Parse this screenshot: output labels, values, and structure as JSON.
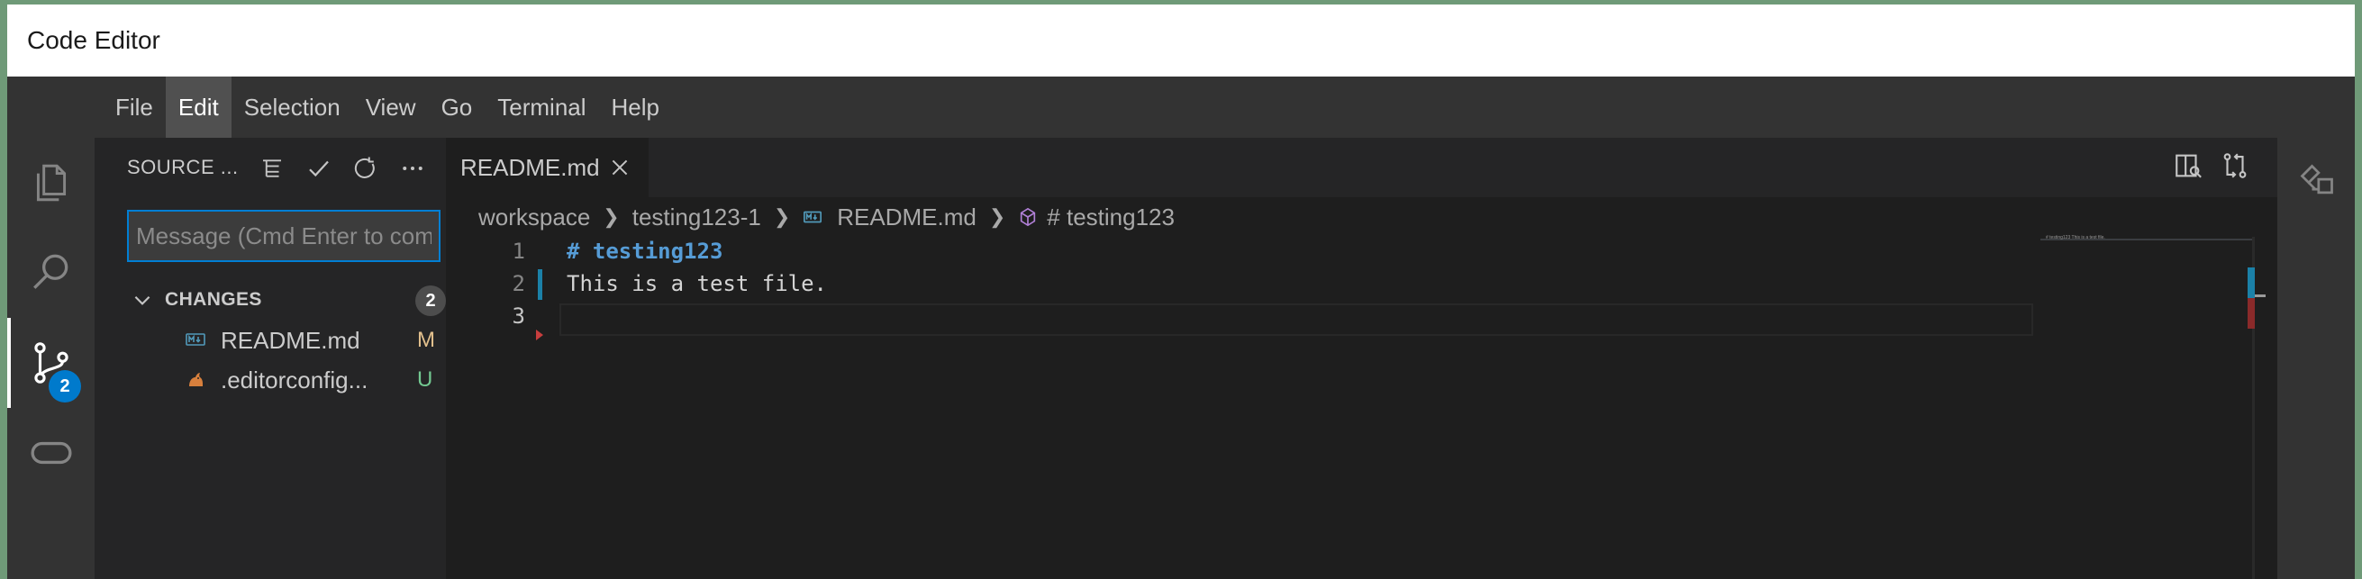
{
  "window": {
    "title": "Code Editor"
  },
  "menu": [
    "File",
    "Edit",
    "Selection",
    "View",
    "Go",
    "Terminal",
    "Help"
  ],
  "activity": {
    "items": [
      {
        "name": "explorer",
        "icon": "files-icon"
      },
      {
        "name": "search",
        "icon": "search-icon"
      },
      {
        "name": "source-control",
        "icon": "source-control-icon",
        "badge": "2"
      },
      {
        "name": "remote",
        "icon": "remote-icon"
      }
    ]
  },
  "sidebar": {
    "title": "SOURCE ...",
    "message_placeholder": "Message (Cmd Enter to commit)",
    "changes_label": "CHANGES",
    "changes_count": "2",
    "files": [
      {
        "name": "README.md",
        "status": "M",
        "status_color": "#e2c08d",
        "icon": "markdown-file-icon"
      },
      {
        "name": ".editorconfig...",
        "status": "U",
        "status_color": "#73c991",
        "icon": "editorconfig-file-icon"
      }
    ]
  },
  "tabs": [
    {
      "label": "README.md",
      "active": true
    }
  ],
  "breadcrumbs": {
    "items": [
      "workspace",
      "testing123-1",
      "README.md",
      "# testing123"
    ]
  },
  "editor": {
    "lines": [
      {
        "number": "1",
        "text": "# testing123"
      },
      {
        "number": "2",
        "text": "This is a test file."
      },
      {
        "number": "3",
        "text": ""
      }
    ],
    "minimap_text": "# testing123 This is a test file."
  },
  "colors": {
    "accent": "#007acc",
    "modified": "#e2c08d",
    "untracked": "#73c991"
  }
}
